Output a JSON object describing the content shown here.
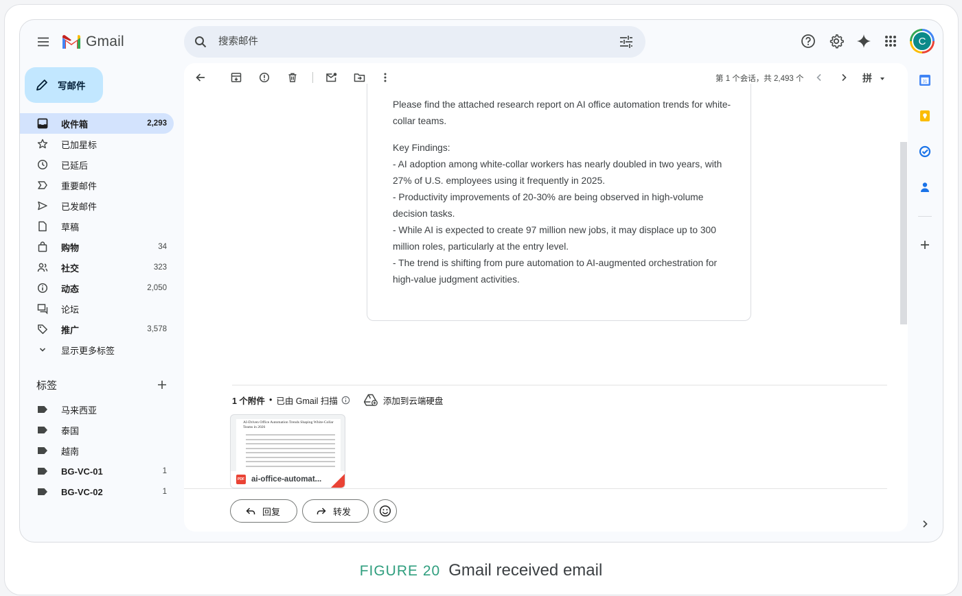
{
  "app": {
    "name": "Gmail"
  },
  "search": {
    "placeholder": "搜索邮件"
  },
  "account": {
    "initial": "C"
  },
  "compose": {
    "label": "写邮件"
  },
  "sidebar": {
    "items": [
      {
        "label": "收件箱",
        "count": "2,293",
        "icon": "inbox-icon"
      },
      {
        "label": "已加星标",
        "count": "",
        "icon": "star-icon"
      },
      {
        "label": "已延后",
        "count": "",
        "icon": "clock-icon"
      },
      {
        "label": "重要邮件",
        "count": "",
        "icon": "important-icon"
      },
      {
        "label": "已发邮件",
        "count": "",
        "icon": "send-icon"
      },
      {
        "label": "草稿",
        "count": "",
        "icon": "draft-icon"
      },
      {
        "label": "购物",
        "count": "34",
        "icon": "shopping-bag-icon"
      },
      {
        "label": "社交",
        "count": "323",
        "icon": "people-icon"
      },
      {
        "label": "动态",
        "count": "2,050",
        "icon": "info-icon"
      },
      {
        "label": "论坛",
        "count": "",
        "icon": "forum-icon"
      },
      {
        "label": "推广",
        "count": "3,578",
        "icon": "tag-icon"
      },
      {
        "label": "显示更多标签",
        "count": "",
        "icon": "chevron-down-icon"
      }
    ],
    "labels_title": "标签",
    "labels": [
      {
        "label": "马来西亚",
        "count": ""
      },
      {
        "label": "泰国",
        "count": ""
      },
      {
        "label": "越南",
        "count": ""
      },
      {
        "label": "BG-VC-01",
        "count": "1"
      },
      {
        "label": "BG-VC-02",
        "count": "1"
      }
    ]
  },
  "toolbar": {
    "pager": "第 1 个会话，共 2,493 个",
    "ime": "拼"
  },
  "email": {
    "intro": "Please find the attached research report on AI office automation trends for white-collar teams.",
    "key_title": "Key Findings:",
    "findings": [
      "- AI adoption among white-collar workers has nearly doubled in two years, with 27% of U.S. employees using it frequently in 2025.",
      "- Productivity improvements of 20-30% are being observed in high-volume decision tasks.",
      "- While AI is expected to create 97 million new jobs, it may displace up to 300 million roles, particularly at the entry level.",
      "- The trend is shifting from pure automation to AI-augmented orchestration for high-value judgment activities."
    ]
  },
  "attachments": {
    "count_label": "1 个附件",
    "scanned": "已由 Gmail 扫描",
    "drive_label": "添加到云端硬盘",
    "file": {
      "name": "ai-office-automat...",
      "preview_title": "AI-Driven Office Automation Trends Shaping White-Collar Teams in 2026",
      "badge": "PDF"
    }
  },
  "actions": {
    "reply": "回复",
    "forward": "转发"
  },
  "caption": {
    "number": "FIGURE 20",
    "text": "Gmail received email"
  },
  "colors": {
    "accent": "#0b57d0",
    "active_bg": "#d3e3fd",
    "compose_bg": "#c2e7ff",
    "avatar": "#0b8a8a"
  }
}
